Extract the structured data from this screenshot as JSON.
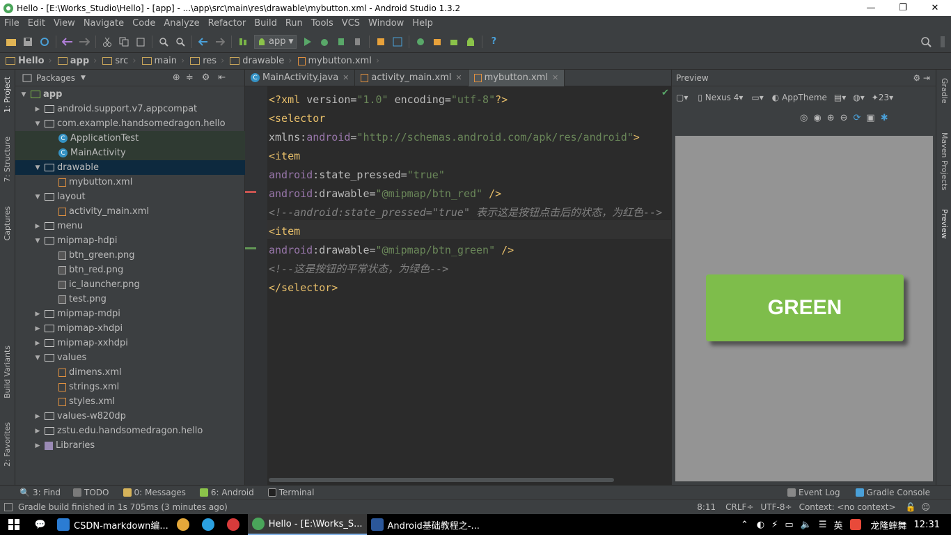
{
  "window": {
    "title": "Hello - [E:\\Works_Studio\\Hello] - [app] - ...\\app\\src\\main\\res\\drawable\\mybutton.xml - Android Studio 1.3.2",
    "minimize": "—",
    "maximize": "❐",
    "close": "✕"
  },
  "menu": [
    "File",
    "Edit",
    "View",
    "Navigate",
    "Code",
    "Analyze",
    "Refactor",
    "Build",
    "Run",
    "Tools",
    "VCS",
    "Window",
    "Help"
  ],
  "toolbar": {
    "run_config": "app",
    "help": "?"
  },
  "breadcrumb": [
    "Hello",
    "app",
    "src",
    "main",
    "res",
    "drawable",
    "mybutton.xml"
  ],
  "left_tabs": {
    "project": "1: Project",
    "structure": "7: Structure",
    "captures": "Captures",
    "build_variants": "Build Variants",
    "favorites": "2: Favorites"
  },
  "right_tabs": {
    "gradle": "Gradle",
    "maven": "Maven Projects",
    "preview": "Preview"
  },
  "project": {
    "view_mode": "Packages",
    "tree": [
      {
        "label": "app",
        "depth": 0,
        "kind": "module",
        "expanded": "open"
      },
      {
        "label": "android.support.v7.appcompat",
        "depth": 1,
        "kind": "folder",
        "expanded": "closed"
      },
      {
        "label": "com.example.handsomedragon.hello",
        "depth": 1,
        "kind": "folder",
        "expanded": "open"
      },
      {
        "label": "ApplicationTest",
        "depth": 2,
        "kind": "class",
        "expanded": ""
      },
      {
        "label": "MainActivity",
        "depth": 2,
        "kind": "class",
        "expanded": ""
      },
      {
        "label": "drawable",
        "depth": 1,
        "kind": "folder",
        "expanded": "open",
        "selected": true
      },
      {
        "label": "mybutton.xml",
        "depth": 2,
        "kind": "xml",
        "expanded": ""
      },
      {
        "label": "layout",
        "depth": 1,
        "kind": "folder",
        "expanded": "open"
      },
      {
        "label": "activity_main.xml",
        "depth": 2,
        "kind": "xml",
        "expanded": ""
      },
      {
        "label": "menu",
        "depth": 1,
        "kind": "folder",
        "expanded": "closed"
      },
      {
        "label": "mipmap-hdpi",
        "depth": 1,
        "kind": "folder",
        "expanded": "open"
      },
      {
        "label": "btn_green.png",
        "depth": 2,
        "kind": "png",
        "expanded": ""
      },
      {
        "label": "btn_red.png",
        "depth": 2,
        "kind": "png",
        "expanded": ""
      },
      {
        "label": "ic_launcher.png",
        "depth": 2,
        "kind": "png",
        "expanded": ""
      },
      {
        "label": "test.png",
        "depth": 2,
        "kind": "png",
        "expanded": ""
      },
      {
        "label": "mipmap-mdpi",
        "depth": 1,
        "kind": "folder",
        "expanded": "closed"
      },
      {
        "label": "mipmap-xhdpi",
        "depth": 1,
        "kind": "folder",
        "expanded": "closed"
      },
      {
        "label": "mipmap-xxhdpi",
        "depth": 1,
        "kind": "folder",
        "expanded": "closed"
      },
      {
        "label": "values",
        "depth": 1,
        "kind": "folder",
        "expanded": "open"
      },
      {
        "label": "dimens.xml",
        "depth": 2,
        "kind": "xml",
        "expanded": ""
      },
      {
        "label": "strings.xml",
        "depth": 2,
        "kind": "xml",
        "expanded": ""
      },
      {
        "label": "styles.xml",
        "depth": 2,
        "kind": "xml",
        "expanded": ""
      },
      {
        "label": "values-w820dp",
        "depth": 1,
        "kind": "folder",
        "expanded": "closed"
      },
      {
        "label": "zstu.edu.handsomedragon.hello",
        "depth": 1,
        "kind": "folder",
        "expanded": "closed"
      },
      {
        "label": "Libraries",
        "depth": 1,
        "kind": "lib",
        "expanded": "closed"
      }
    ]
  },
  "editor": {
    "tabs": [
      {
        "label": "MainActivity.java",
        "icon": "class-icon",
        "active": false
      },
      {
        "label": "activity_main.xml",
        "icon": "xml-file-icon",
        "active": false
      },
      {
        "label": "mybutton.xml",
        "icon": "xml-file-icon",
        "active": true
      }
    ],
    "lines": [
      [
        [
          "c-pi",
          "<?xml "
        ],
        [
          "c-attr",
          "version="
        ],
        [
          "c-val",
          "\"1.0\""
        ],
        [
          "c-attr",
          " encoding="
        ],
        [
          "c-val",
          "\"utf-8\""
        ],
        [
          "c-pi",
          "?>"
        ]
      ],
      [
        [
          "c-tag",
          "<selector"
        ]
      ],
      [
        [
          "c-attr",
          "  xmlns:"
        ],
        [
          "c-ns",
          "android"
        ],
        [
          "c-attr",
          "="
        ],
        [
          "c-val",
          "\"http://schemas.android.com/apk/res/android\""
        ],
        [
          "c-tag",
          ">"
        ]
      ],
      [
        [
          "c-tag",
          "    <item"
        ]
      ],
      [
        [
          "c-ns",
          "        android"
        ],
        [
          "c-attr",
          ":state_pressed="
        ],
        [
          "c-val",
          "\"true\""
        ]
      ],
      [
        [
          "c-ns",
          "        android"
        ],
        [
          "c-attr",
          ":drawable="
        ],
        [
          "c-val",
          "\"@mipmap/btn_red\""
        ],
        [
          "c-tag",
          " />"
        ]
      ],
      [
        [
          "c-com",
          "    <!--android:state_pressed=\"true\" 表示这是按钮点击后的状态，为红色-->"
        ]
      ],
      [
        [
          "c-tag",
          "    <item "
        ]
      ],
      [
        [
          "c-ns",
          "        android"
        ],
        [
          "c-attr",
          ":drawable="
        ],
        [
          "c-val",
          "\"@mipmap/btn_green\""
        ],
        [
          "c-tag",
          " />"
        ]
      ],
      [
        [
          "c-com",
          "    <!--这是按钮的平常状态，为绿色-->"
        ]
      ],
      [
        [
          "c-tag",
          "</selector>"
        ]
      ]
    ]
  },
  "preview": {
    "title": "Preview",
    "device": "Nexus 4",
    "theme": "AppTheme",
    "api": "23",
    "button_text": "GREEN"
  },
  "tool_tabs": {
    "find": "3: Find",
    "todo": "TODO",
    "messages": "0: Messages",
    "android": "6: Android",
    "terminal": "Terminal",
    "event_log": "Event Log",
    "gradle_console": "Gradle Console"
  },
  "status": {
    "message": "Gradle build finished in 1s 705ms (3 minutes ago)",
    "position": "8:11",
    "line_sep": "CRLF÷",
    "encoding": "UTF-8÷",
    "context": "Context: <no context>"
  },
  "taskbar": {
    "tasks": [
      {
        "label": "CSDN-markdown编...",
        "icon": "edge-icon",
        "active": false
      },
      {
        "label": "",
        "icon": "chrome-icon",
        "active": false
      },
      {
        "label": "",
        "icon": "skype-icon",
        "active": false
      },
      {
        "label": "",
        "icon": "netease-music-icon",
        "active": false
      },
      {
        "label": "Hello - [E:\\Works_S...",
        "icon": "android-studio-icon",
        "active": true
      },
      {
        "label": "Android基础教程之-...",
        "icon": "word-icon",
        "active": false
      }
    ],
    "ime": "英",
    "user": "龙隆蟀舞",
    "clock": "12:31"
  },
  "colors": {
    "accent": "#7ebd4b",
    "editor_bg": "#2b2b2b",
    "panel_bg": "#3c3f41",
    "selection": "#0d293e"
  }
}
